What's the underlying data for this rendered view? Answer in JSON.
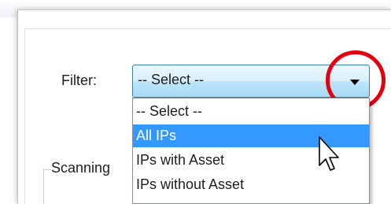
{
  "filter": {
    "label": "Filter:",
    "selected_value": "-- Select --",
    "options": [
      {
        "label": "-- Select --"
      },
      {
        "label": "All IPs"
      },
      {
        "label": "IPs with Asset"
      },
      {
        "label": "IPs without Asset"
      }
    ],
    "highlighted_option": "All IPs"
  },
  "group": {
    "legend": "Scanning"
  },
  "colors": {
    "highlight_circle": "#e3000f",
    "selected_item_bg": "#3399ff",
    "select_border": "#3c7fb1"
  },
  "icons": {
    "dropdown_arrow": "chevron-down-icon",
    "cursor": "mouse-pointer-icon"
  }
}
